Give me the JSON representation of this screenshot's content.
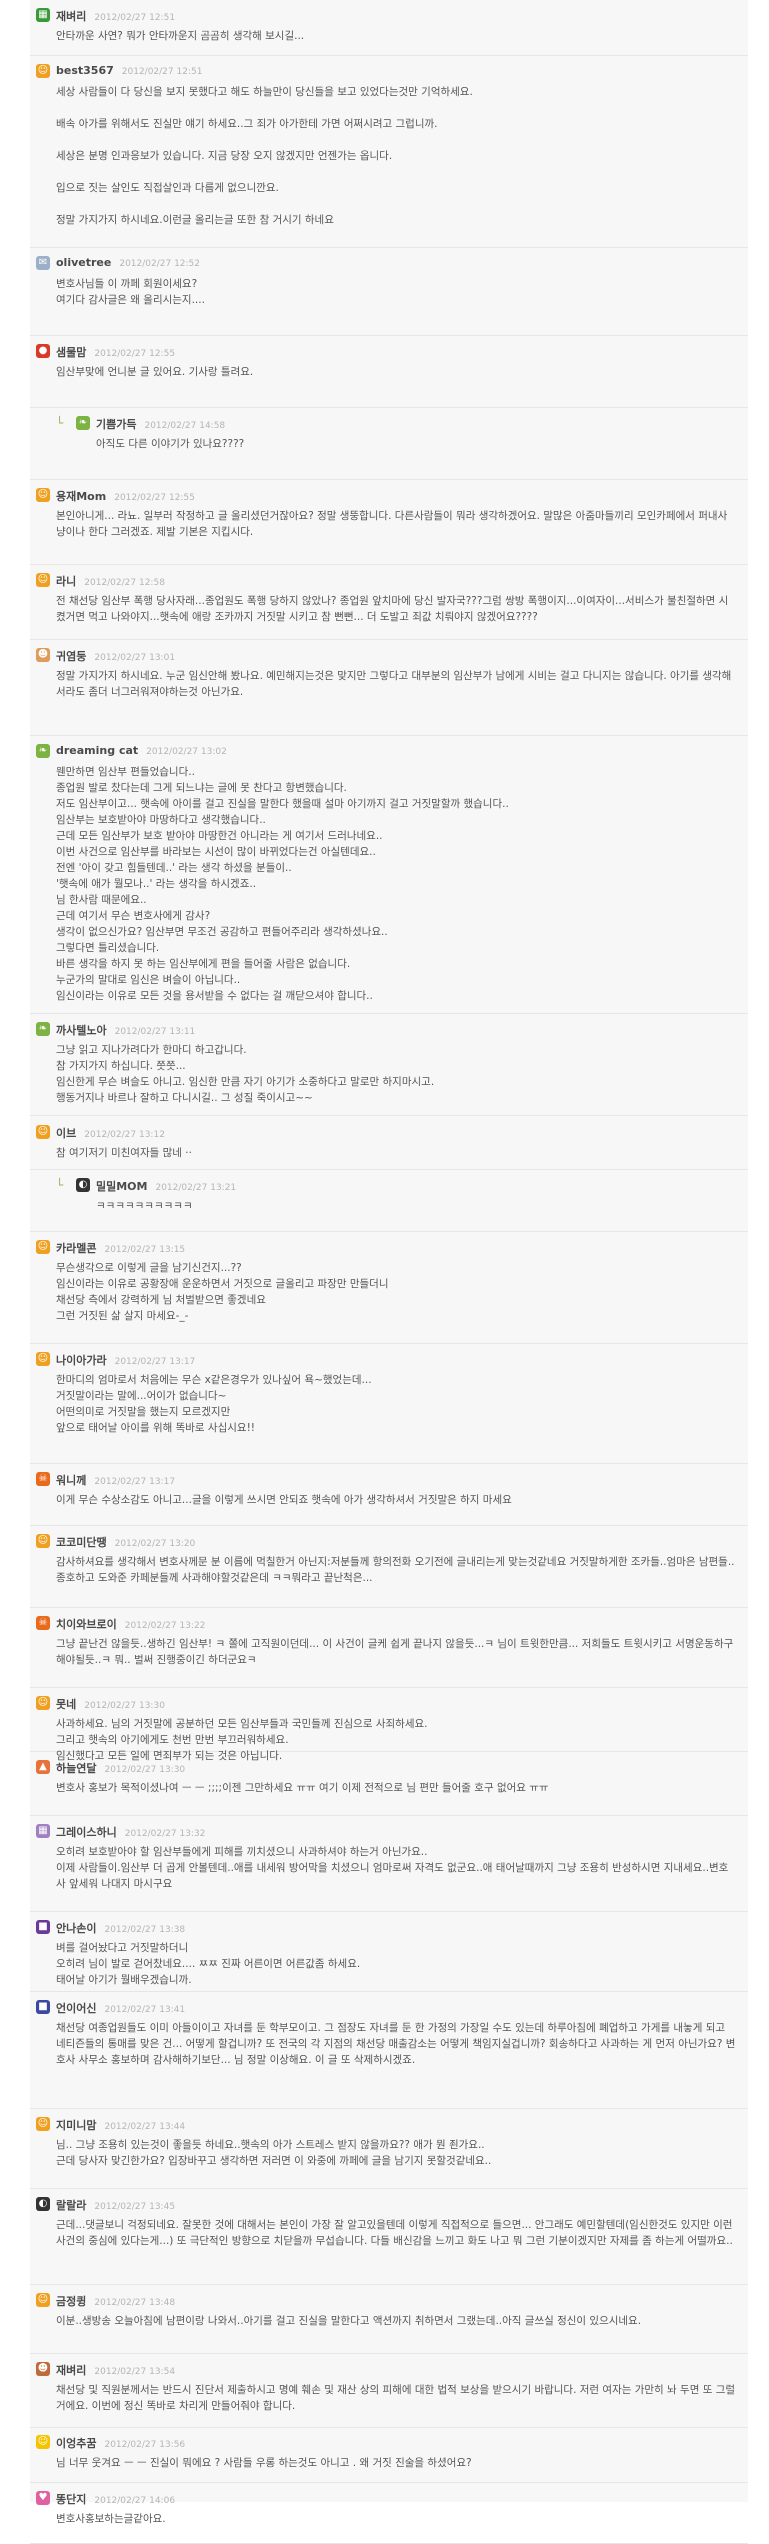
{
  "comments": [
    {
      "name": "재벼리",
      "date": "2012/02/27 12:51",
      "body": "안타까운 사연? 뭐가 안타까운지 곰곰히 생각해 보시길...",
      "avatar": "grid-icon",
      "color": "#3a9a3a"
    },
    {
      "name": "best3567",
      "date": "2012/02/27 12:51",
      "body": "세상 사람들이 다 당신을 보지 못했다고 해도 하늘만이 당신들을 보고 있었다는것만 기억하세요.\n\n배속 아가를 위해서도 진실만 얘기 하세요..그 죄가 아가한테 가면 어쩌시려고 그럽니까.\n\n세상은 분명 인과응보가 있습니다. 지금 당장 오지 않겠지만 언젠가는 옵니다.\n\n입으로 짓는 살인도 직접살인과 다름게 없으니깐요.\n\n정말 가지가지 하시네요.이런글 올리는글 또한 참 거시기 하네요",
      "avatar": "smile-icon",
      "color": "#f0a020"
    },
    {
      "name": "olivetree",
      "date": "2012/02/27 12:52",
      "body": "변호사님들 이 까페 회원이세요?\n여기다 감사글은 왜 올리시는지....",
      "avatar": "note-icon",
      "color": "#9bb0c8"
    },
    {
      "name": "샘물맘",
      "date": "2012/02/27 12:55",
      "body": "임산부맞에 언니분 글 있어요. 기사랑 틀려요.",
      "avatar": "tomato-icon",
      "color": "#d83a2a"
    },
    {
      "name": "기쁨가득",
      "date": "2012/02/27 14:58",
      "body": "아직도 다른 이야기가 있나요????",
      "avatar": "leaf-icon",
      "color": "#7cb342",
      "reply": true
    },
    {
      "name": "용재Mom",
      "date": "2012/02/27 12:55",
      "body": "본인아니게... 라뇨. 일부러 작정하고 글 올리셨던거잖아요? 정말 생뚱합니다. 다른사람들이 뭐라 생각하겠어요. 말많은 아줌마들끼리 모인카페에서 퍼내사냥이나 한다 그러겠죠. 제발 기본은 지킵시다.",
      "avatar": "smile-icon",
      "color": "#f0a020"
    },
    {
      "name": "라니",
      "date": "2012/02/27 12:58",
      "body": "전 채선당 임산부 폭행 당사자래...종업원도 폭행 당하지 않았나? 종업원 앞치마에 당신 발자국???그럼 쌍방 폭행이지...이여자이...서비스가 불친절하면 시켰거면 먹고 나와야지...햇속에 애랑 조카까지 거짓말 시키고 참 뻔뻔... 더 도발고 죄값 치뤄야지 않겠어요????",
      "avatar": "smile-icon",
      "color": "#f0a020"
    },
    {
      "name": "귀염둥",
      "date": "2012/02/27 13:01",
      "body": "정말 가지가지 하시네요. 누군 임신안해 봤나요. 예민해지는것은 맞지만 그렇다고 대부분의 임산부가 남에게 시비는 걸고 다니지는 않습니다. 아기를 생각해서라도 좀더 너그러워져야하는것 아닌가요.",
      "avatar": "face-icon",
      "color": "#e09a5a"
    },
    {
      "name": "dreaming cat",
      "date": "2012/02/27 13:02",
      "body": "웬만하면 임산부 편들었습니다..\n종업원 발로 찼다는데 그게 되느냐는 글에 못 찬다고 항변했습니다.\n저도 임산부이고... 햇속에 아이를 걸고 진실을 말한다 했을때 설마 아기까지 걸고 거짓말할까 했습니다..\n임산부는 보호받아야 마땅하다고 생각했습니다..\n근데 모든 임산부가 보호 받아야 마땅한건 아니라는 게 여기서 드러나네요..\n이번 사건으로 임산부를 바라보는 시선이 많이 바뀌었다는건 아실텐데요..\n전엔 '아이 갖고 힘들텐데..' 라는 생각 하셨을 분들이..\n'햇속에 애가 뭘모나..' 라는 생각을 하시겠죠..\n님 한사람 때문에요..\n근데 여기서 무슨 변호사에게 감사?\n생각이 없으신가요? 임산부면 무조건 공감하고 편들어주리라 생각하셨나요..\n그렇다면 틀리셨습니다.\n바른 생각을 하지 못 하는 임산부에게 편을 들어줄 사람은 없습니다.\n누군가의 말대로 임신은 벼슬이 아닙니다..\n임신이라는 이유로 모든 것을 용서받을 수 없다는 걸 깨닫으셔야 합니다..",
      "avatar": "leaf-icon",
      "color": "#7cb342"
    },
    {
      "name": "까사텔노아",
      "date": "2012/02/27 13:11",
      "body": "그냥 읽고 지나가려다가 한마디 하고갑니다.\n참 가지가지 하십니다. 쯧쯧...\n임신한게 무슨 벼슬도 아니고. 임신한 만큼 자기 아기가 소중하다고 말로만 하지마시고.\n행동거지나 바르나 잘하고 다니시길.. 그 성질 죽이시고~~",
      "avatar": "leaf-icon",
      "color": "#7cb342"
    },
    {
      "name": "이브",
      "date": "2012/02/27 13:12",
      "body": "참 여기저기 미친여자들 많네 ··",
      "avatar": "smile-icon",
      "color": "#f0a020"
    },
    {
      "name": "밀밀MOM",
      "date": "2012/02/27 13:21",
      "body": "ㅋㅋㅋㅋㅋㅋㅋㅋㅋㅋ",
      "avatar": "panda-icon",
      "color": "#333333",
      "reply": true
    },
    {
      "name": "카라멜콘",
      "date": "2012/02/27 13:15",
      "body": "무슨생각으로 이렇게 글을 남기신건지...??\n임신이라는 이유로 공황장애 운운하면서 거짓으로 글올리고 파장만 만들더니\n채선당 측에서 강력하게 님 처벌받으면 좋겠네요\n그런 거짓된 삶 살지 마세요-_-",
      "avatar": "smile-icon",
      "color": "#f0a020"
    },
    {
      "name": "나이아가라",
      "date": "2012/02/27 13:17",
      "body": "한마디의 엄마로서 처음에는 무슨 x같은경우가 있나싶어 욕~했었는데...\n거짓말이라는 말에...어이가 없습니다~\n어떤의미로 거짓말을 했는지 모르겠지만\n앞으로 태어날 아이를 위해 똑바로 사십시요!!",
      "avatar": "smile-icon",
      "color": "#f0a020"
    },
    {
      "name": "워니께",
      "date": "2012/02/27 13:17",
      "body": "이게 무슨 수상소감도 아니고...글을 이렇게 쓰시면 안되죠 햇속에 아가 생각하셔서 거짓말은 하지 마세요",
      "avatar": "angry-icon",
      "color": "#e86a1a"
    },
    {
      "name": "코코미단땡",
      "date": "2012/02/27 13:20",
      "body": "감사하셔요를 생각해서 변호사께문 분 이름에 먹칠한거 아닌지:저분들께 항의전화 오기전에 글내리는게 맞는것같네요 거짓말하게한 조카들..엄마은 남편들..종호하고 도와준 카페분들께 사과해야할것같은데 ㅋㅋ뭐라고 끝난척은...",
      "avatar": "smile-icon",
      "color": "#f0a020"
    },
    {
      "name": "치이와브로이",
      "date": "2012/02/27 13:22",
      "body": "그냥 끝난건 않을듯..생하긴 임산부! ㅋ 쫄에 고직원이던데... 이 사건이 글케 쉽게 끝나지 않을듯...ㅋ 님이 트윗한만큼... 저희들도 트윗시키고 서명운동하구 해야될듯..ㅋ 뭐.. 벌써 진행중이긴 하더군요ㅋ",
      "avatar": "angry-icon",
      "color": "#e86a1a"
    },
    {
      "name": "못네",
      "date": "2012/02/27 13:30",
      "body": "사과하세요. 님의 거짓말에 공분하던 모든 임산부들과 국민들께 진심으로 사죄하세요.\n그리고 햇속의 아기에게도 천번 만번 부끄러워하세요.\n임신했다고 모든 일에 면죄부가 되는 것은 아닙니다.",
      "avatar": "smile-icon",
      "color": "#f0a020"
    },
    {
      "name": "하늘연달",
      "date": "2012/02/27 13:30",
      "body": "변호사 홍보가 목적이셨나여 ㅡ ㅡ ;;;;이젠 그만하세요 ㅠㅠ 여기 이제 전적으로 님 편만 들어줄 호구 없어요 ㅠㅠ",
      "avatar": "fox-icon",
      "color": "#e8733a"
    },
    {
      "name": "그레이스하니",
      "date": "2012/02/27 13:32",
      "body": "오히려 보호받아야 할 임산부들에게 피해를 끼치셨으니 사과하셔야 하는거 아닌가요..\n이제 사람들이.임산부 더 곱게 안볼텐데..애를 내세워 방어막을 치셨으니 엄마로써 자격도 없군요..애 태어날때까지 그냥 조용히 반성하시면 지내세요..변호사 앞세워 나대지 마시구요",
      "avatar": "grid-icon",
      "color": "#a080c0"
    },
    {
      "name": "안나손이",
      "date": "2012/02/27 13:38",
      "body": "벼를 걸어놨다고 거짓말하더니\n오히려 님이 발로 걷어찼네요.... ㅉㅉ 진짜 어른이면 어른값좀 하세요.\n태어날 아기가 뭘배우겠습니까.",
      "avatar": "square-icon",
      "color": "#6a3a9a"
    },
    {
      "name": "언이어신",
      "date": "2012/02/27 13:41",
      "body": "채선당 여종업원들도 이미 아들이이고 자녀를 둔 학부모이고. 그 점장도 자녀를 둔 한 가정의 가장일 수도 있는데 하루아침에 폐업하고 가게를 내놓게 되고 네티즌들의 통매를 맞은 건... 어떻게 할겁니까? 또 전국의 각 지점의 채선당 매출감소는 어떻게 책임지실겁니까? 회송하다고 사과하는 게 먼저 아닌가요? 변호사 사무소 홍보하며 감사해하기보단... 님 정말 이상해요. 이 글 또 삭제하시겠죠.",
      "avatar": "square-icon",
      "color": "#3a4aa0"
    },
    {
      "name": "지미니맘",
      "date": "2012/02/27 13:44",
      "body": "님.. 그냥 조용히 있는것이 좋을듯 하네요..햇속의 아가 스트레스 받지 않을까요?? 애가 뭔 죈가요..\n근데 당사자 맞긴한가요? 입장바꾸고 생각하면 저러면 이 와중에 까페에 글을 남기지 못할것같네요..",
      "avatar": "smile-icon",
      "color": "#f0a020"
    },
    {
      "name": "랄랄라",
      "date": "2012/02/27 13:45",
      "body": "근데...댓글보니 걱정되네요. 잘못한 것에 대해서는 본인이 가장 잘 알고있을텐데 이렇게 직접적으로 들으면... 안그래도 예민할텐데(임신한것도 있지만 이런 사건의 중심에 있다는게...) 또 극단적인 방향으로 치닫을까 무섭습니다. 다들 배신감을 느끼고 화도 나고 뭐 그런 기분이겠지만 자제를 좀 하는게 어떨까요..",
      "avatar": "panda-icon",
      "color": "#333333"
    },
    {
      "name": "금정큉",
      "date": "2012/02/27 13:48",
      "body": "이분..생방송 오늘아침에 남편이랑 나와서..아기를 걸고 진실을 말한다고 액션까지 취하면서 그랬는데..아직 글쓰실 정신이 있으시네요.",
      "avatar": "smile-icon",
      "color": "#f0a020"
    },
    {
      "name": "재벼리",
      "date": "2012/02/27 13:54",
      "body": "채선당 및 직원분께서는 반드시 진단서 제출하시고 명예 훼손 및 재산 상의 피해에 대한 법적 보상을 받으시기 바랍니다. 저런 여자는 가만히 놔 두면 또 그럴 거에요. 이번에 정신 똑바로 차리게 만들어줘야 합니다.",
      "avatar": "face-icon",
      "color": "#c06a3a"
    },
    {
      "name": "이엉추꿈",
      "date": "2012/02/27 13:56",
      "body": "님 너무 웃겨요 ㅡ ㅡ 진실이 뭐에요 ? 사람들 우롱 하는것도 아니고 . 왜 거짓 진술을 하셨어요?",
      "avatar": "happy-icon",
      "color": "#f5c400"
    },
    {
      "name": "똥단지",
      "date": "2012/02/27 14:06",
      "body": "변호사홍보하는글같아요.",
      "avatar": "heart-icon",
      "color": "#e060a0"
    }
  ]
}
